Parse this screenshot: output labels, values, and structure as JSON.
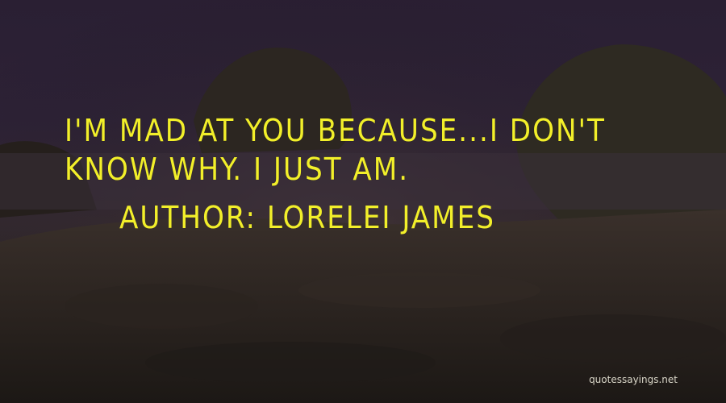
{
  "quote": {
    "text": "I'm mad at you because...I don't know why. I just am.",
    "author": "Author: Lorelei James"
  },
  "watermark": "quotessayings.net",
  "colors": {
    "text": "#f2ef2a",
    "sky": "#2d2236",
    "rocks": "#2a241f"
  }
}
